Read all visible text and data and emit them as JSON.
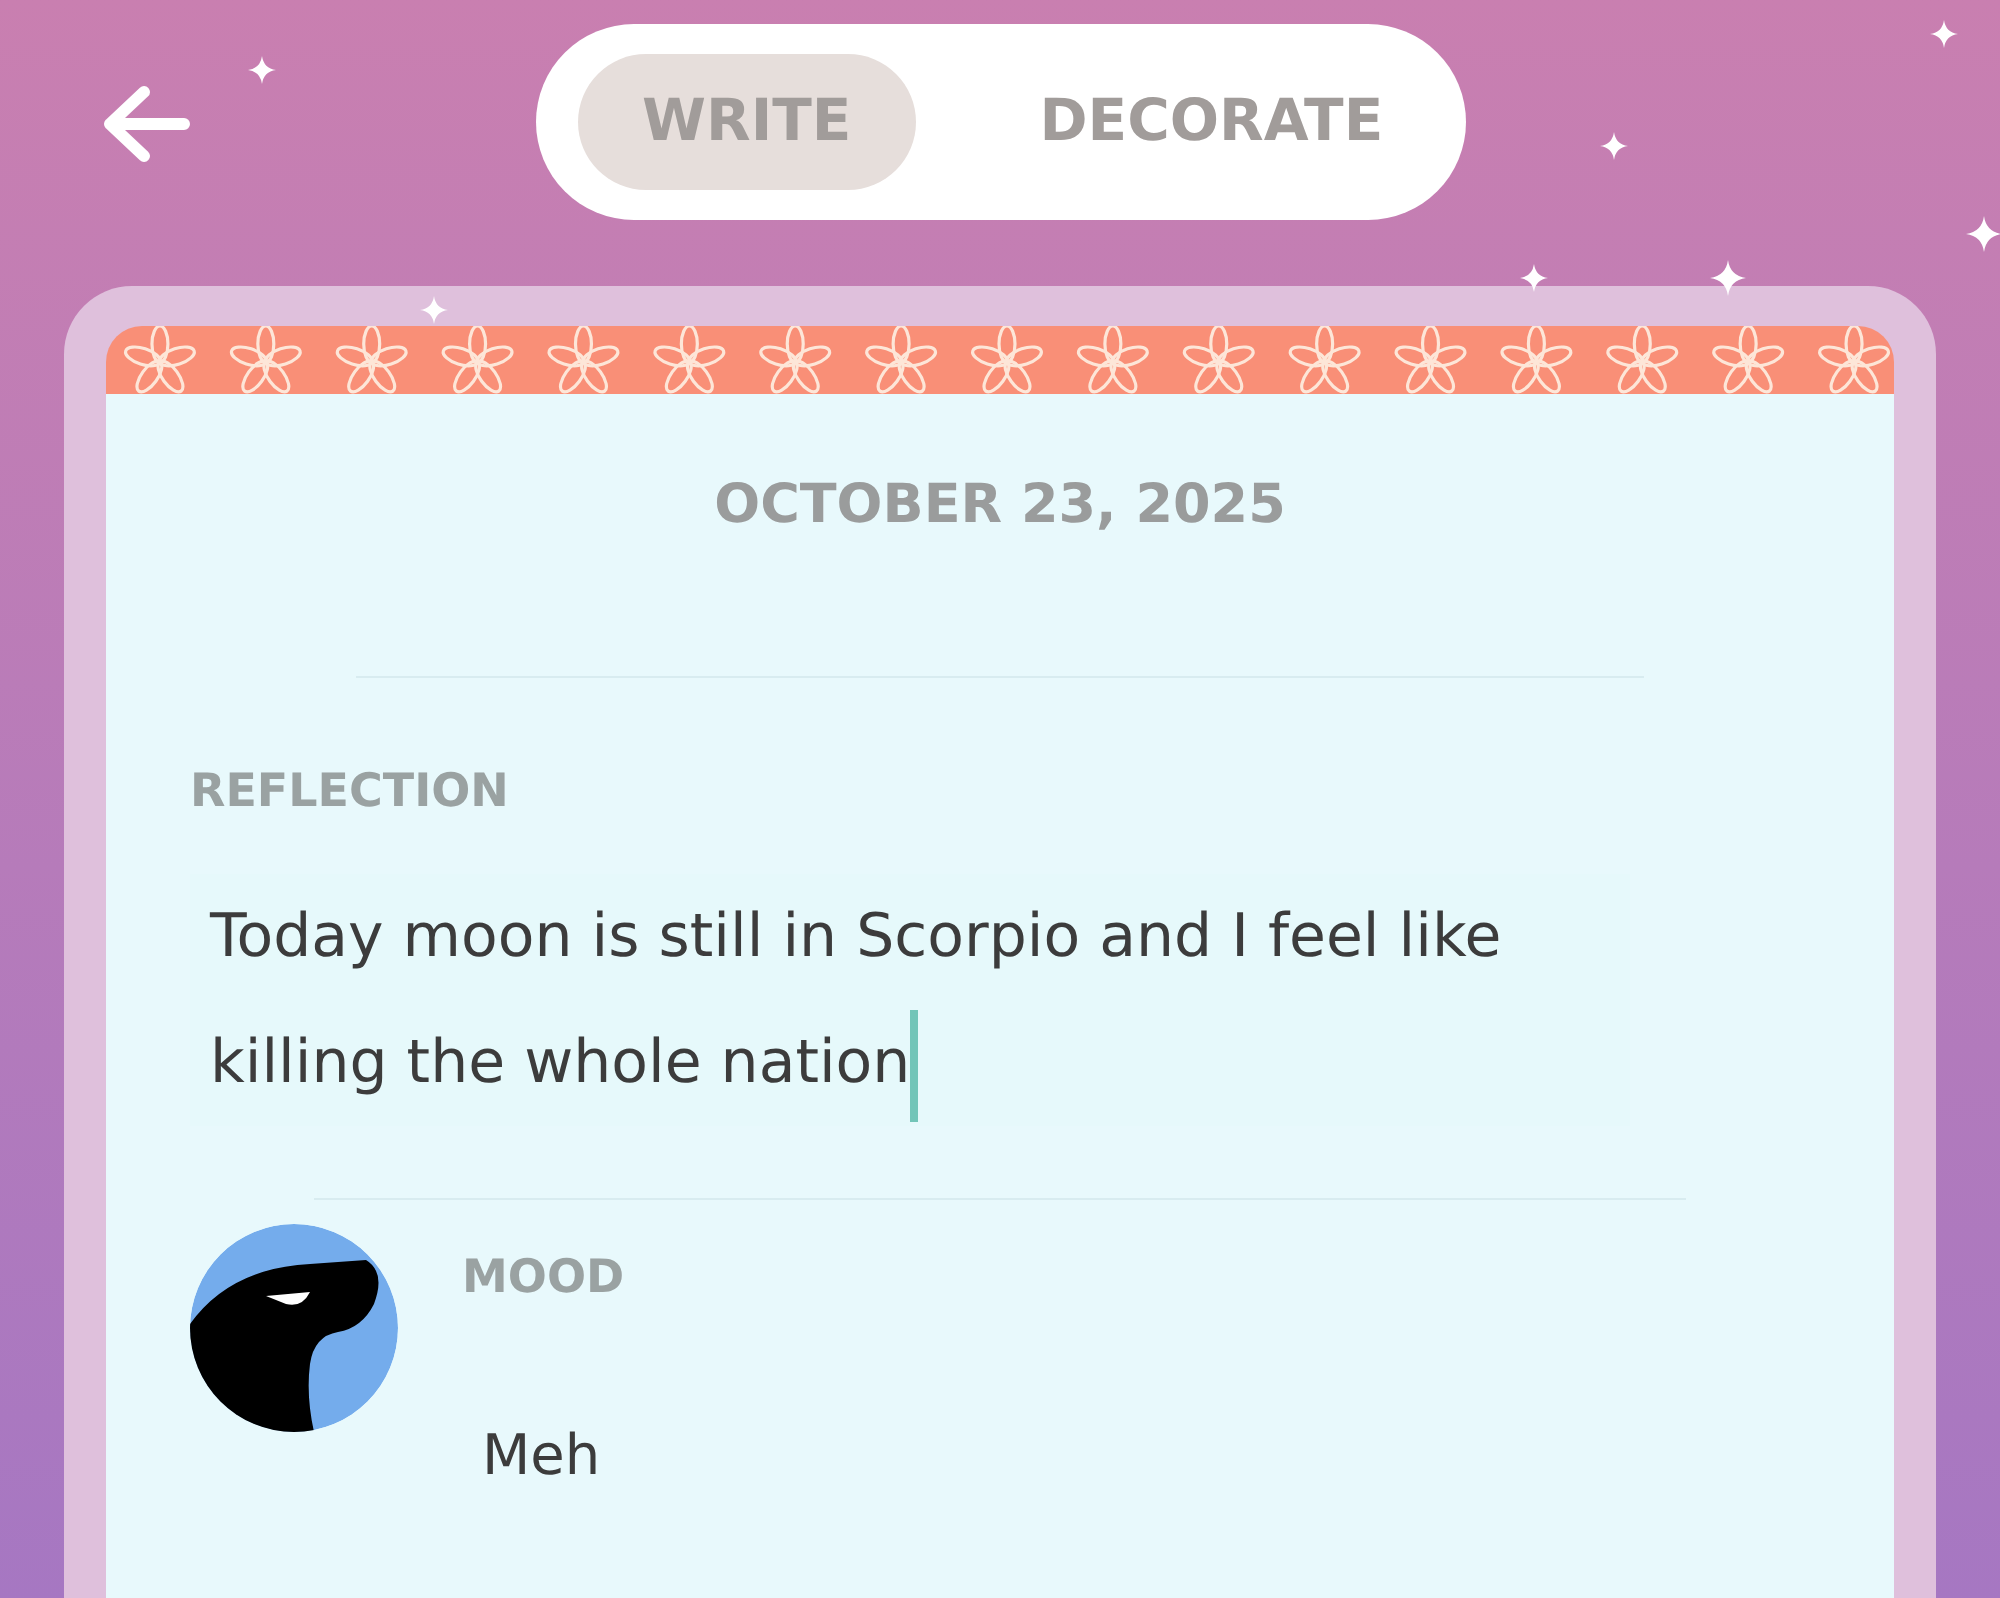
{
  "tabs": [
    {
      "label": "WRITE",
      "selected": true
    },
    {
      "label": "DECORATE",
      "selected": false
    }
  ],
  "entry": {
    "date": "OCTOBER 23, 2025",
    "reflection": {
      "label": "REFLECTION",
      "value": "Today moon is still in Scorpio and I feel like killing the whole nation",
      "focused": true
    },
    "mood": {
      "label": "MOOD",
      "value": "Meh"
    }
  }
}
